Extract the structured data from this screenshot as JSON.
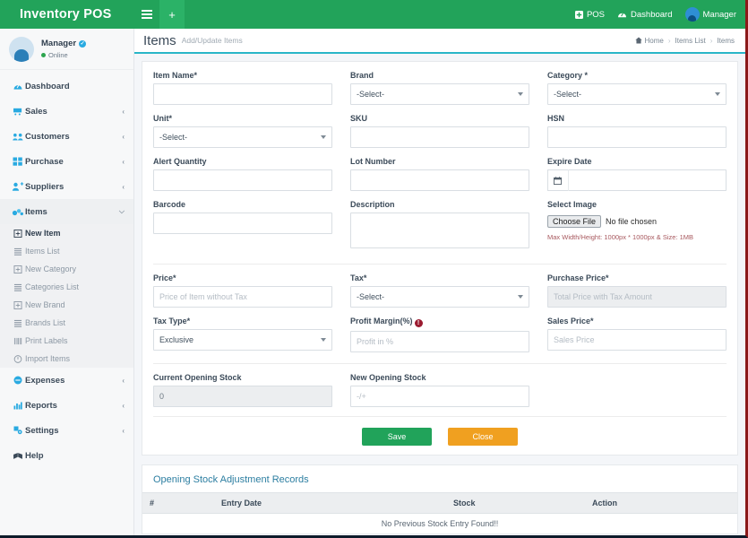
{
  "topbar": {
    "brand": "Inventory POS",
    "menu_toggle": "menu-icon",
    "add_label": "+",
    "links": [
      {
        "label": "POS",
        "icon": "pos-icon"
      },
      {
        "label": "Dashboard",
        "icon": "dashboard-icon"
      },
      {
        "label": "Manager",
        "icon": "user-avatar"
      }
    ]
  },
  "sidebar": {
    "profile": {
      "name": "Manager",
      "status": "Online",
      "verified": "✓"
    },
    "items": [
      {
        "label": "Dashboard",
        "icon": "dashboard-icon",
        "caret": ""
      },
      {
        "label": "Sales",
        "icon": "cart-icon",
        "caret": "‹"
      },
      {
        "label": "Customers",
        "icon": "users-icon",
        "caret": "‹"
      },
      {
        "label": "Purchase",
        "icon": "grid-icon",
        "caret": "‹"
      },
      {
        "label": "Suppliers",
        "icon": "user-plus-icon",
        "caret": "‹"
      },
      {
        "label": "Items",
        "icon": "boxes-icon",
        "caret": "⌵"
      }
    ],
    "sub_items": [
      {
        "label": "New Item",
        "icon": "plus-square-icon",
        "current": true
      },
      {
        "label": "Items List",
        "icon": "list-icon",
        "current": false
      },
      {
        "label": "New Category",
        "icon": "plus-square-icon",
        "current": false
      },
      {
        "label": "Categories List",
        "icon": "list-icon",
        "current": false
      },
      {
        "label": "New Brand",
        "icon": "plus-square-icon",
        "current": false
      },
      {
        "label": "Brands List",
        "icon": "list-icon",
        "current": false
      },
      {
        "label": "Print Labels",
        "icon": "barcode-icon",
        "current": false
      },
      {
        "label": "Import Items",
        "icon": "import-icon",
        "current": false
      }
    ],
    "items_after": [
      {
        "label": "Expenses",
        "icon": "minus-circle-icon",
        "caret": "‹"
      },
      {
        "label": "Reports",
        "icon": "chart-icon",
        "caret": "‹"
      },
      {
        "label": "Settings",
        "icon": "gear-icon",
        "caret": "‹"
      },
      {
        "label": "Help",
        "icon": "book-icon",
        "caret": ""
      }
    ]
  },
  "page": {
    "title": "Items",
    "subtitle": "Add/Update Items",
    "breadcrumb": [
      {
        "label": "Home",
        "icon": "home-icon"
      },
      {
        "label": "Items List",
        "icon": ""
      },
      {
        "label": "Items",
        "icon": ""
      }
    ],
    "breadcrumb_sep": "›"
  },
  "form": {
    "item_name": {
      "label": "Item Name*",
      "value": "",
      "placeholder": ""
    },
    "brand": {
      "label": "Brand",
      "value": "-Select-"
    },
    "category": {
      "label": "Category *",
      "value": "-Select-"
    },
    "unit": {
      "label": "Unit*",
      "value": "-Select-"
    },
    "sku": {
      "label": "SKU",
      "value": "",
      "placeholder": ""
    },
    "hsn": {
      "label": "HSN",
      "value": "",
      "placeholder": ""
    },
    "alert_quantity": {
      "label": "Alert Quantity",
      "value": "",
      "placeholder": ""
    },
    "lot_number": {
      "label": "Lot Number",
      "value": "",
      "placeholder": ""
    },
    "expire_date": {
      "label": "Expire Date",
      "value": "",
      "placeholder": "",
      "icon": "calendar-icon"
    },
    "barcode": {
      "label": "Barcode",
      "value": "",
      "placeholder": ""
    },
    "description": {
      "label": "Description",
      "value": "",
      "placeholder": ""
    },
    "select_image": {
      "label": "Select Image",
      "button": "Choose File",
      "no_file": "No file chosen",
      "hint": "Max Width/Height: 1000px * 1000px & Size: 1MB"
    },
    "price": {
      "label": "Price*",
      "value": "",
      "placeholder": "Price of Item without Tax"
    },
    "tax": {
      "label": "Tax*",
      "value": "-Select-"
    },
    "purchase_price": {
      "label": "Purchase Price*",
      "value": "",
      "placeholder": "Total Price with Tax Amount"
    },
    "tax_type": {
      "label": "Tax Type*",
      "value": "Exclusive"
    },
    "profit_margin": {
      "label": "Profit Margin(%)",
      "value": "",
      "placeholder": "Profit in %",
      "warn": "!"
    },
    "sales_price": {
      "label": "Sales Price*",
      "value": "",
      "placeholder": "Sales Price"
    },
    "current_opening_stock": {
      "label": "Current Opening Stock",
      "value": "0"
    },
    "new_opening_stock": {
      "label": "New Opening Stock",
      "value": "",
      "placeholder": "-/+"
    },
    "save_label": "Save",
    "close_label": "Close"
  },
  "records": {
    "title": "Opening Stock Adjustment Records",
    "columns": [
      "#",
      "Entry Date",
      "Stock",
      "Action"
    ],
    "empty_message": "No Previous Stock Entry Found!!"
  },
  "colors": {
    "brand_green": "#22a35a",
    "accent_cyan": "#29b6c8",
    "icon_blue": "#29aae1",
    "warning_orange": "#f0a020",
    "danger_red": "#9b1b30"
  }
}
